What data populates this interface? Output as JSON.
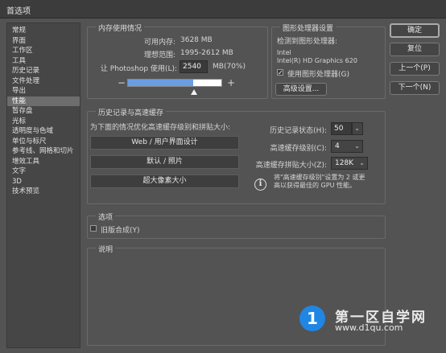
{
  "window": {
    "title": "首选项"
  },
  "sidebar": {
    "items": [
      {
        "label": "常规"
      },
      {
        "label": "界面"
      },
      {
        "label": "工作区"
      },
      {
        "label": "工具"
      },
      {
        "label": "历史记录"
      },
      {
        "label": "文件处理"
      },
      {
        "label": "导出"
      },
      {
        "label": "性能",
        "active": true
      },
      {
        "label": "暂存盘"
      },
      {
        "label": "光标"
      },
      {
        "label": "透明度与色域"
      },
      {
        "label": "单位与标尺"
      },
      {
        "label": "参考线、网格和切片"
      },
      {
        "label": "增效工具"
      },
      {
        "label": "文字"
      },
      {
        "label": "3D"
      },
      {
        "label": "技术预览"
      }
    ]
  },
  "memory": {
    "title": "内存使用情况",
    "available_label": "可用内存:",
    "available_value": "3628 MB",
    "ideal_label": "理想范围:",
    "ideal_value": "1995-2612 MB",
    "let_use_label": "让 Photoshop 使用(L):",
    "let_use_value": "2540",
    "let_use_unit": "MB(70%)",
    "minus": "−",
    "plus": "+",
    "slider_percent": 70
  },
  "gpu": {
    "title": "图形处理器设置",
    "detected_label": "检测到图形处理器:",
    "vendor": "Intel",
    "model": "Intel(R) HD Graphics 620",
    "use_gpu_label": "使用图形处理器(G)",
    "use_gpu_checked": "✓",
    "advanced_button": "高级设置..."
  },
  "history_cache": {
    "title": "历史记录与高速缓存",
    "optimize_label": "为下面的情况优化高速缓存级别和拼贴大小:",
    "preset_buttons": [
      "Web / 用户界面设计",
      "默认 / 照片",
      "超大像素大小"
    ],
    "history_states_label": "历史记录状态(H):",
    "history_states_value": "50",
    "cache_levels_label": "高速缓存级别(C):",
    "cache_levels_value": "4",
    "tile_size_label": "高速缓存拼贴大小(Z):",
    "tile_size_value": "128K",
    "note_line1": "将\"高速缓存级别\"设置为 2 或更",
    "note_line2": "高以获得最佳的 GPU 性能。",
    "info_glyph": "i"
  },
  "options": {
    "title": "选项",
    "legacy_label": "旧版合成(Y)"
  },
  "description": {
    "title": "说明"
  },
  "buttons": {
    "ok": "确定",
    "reset": "复位",
    "prev": "上一个(P)",
    "next": "下一个(N)"
  },
  "watermark": {
    "logo_glyph": "1",
    "title": "第一区自学网",
    "url": "www.d1qu.com"
  },
  "colors": {
    "background": "#535353",
    "slider_fill": "#6a9ee4",
    "logo_blue": "#1f86e4"
  }
}
